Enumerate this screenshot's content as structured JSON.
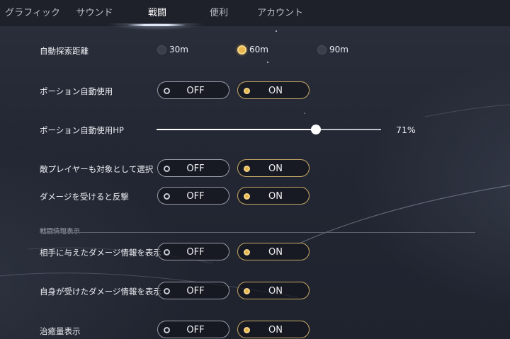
{
  "tabs": [
    {
      "label": "グラフィック"
    },
    {
      "label": "サウンド"
    },
    {
      "label": "戦闘"
    },
    {
      "label": "便利"
    },
    {
      "label": "アカウント"
    }
  ],
  "active_tab": "戦闘",
  "auto_search": {
    "label": "自動探索距離",
    "options": [
      "30m",
      "60m",
      "90m"
    ],
    "selected": "60m"
  },
  "potion_auto": {
    "label": "ポーション自動使用",
    "off": "OFF",
    "on": "ON",
    "value": "ON"
  },
  "potion_hp": {
    "label": "ポーション自動使用HP",
    "value_text": "71%",
    "value": 0.71
  },
  "target_player": {
    "label": "敵プレイヤーも対象として選択",
    "off": "OFF",
    "on": "ON",
    "value": "ON"
  },
  "counterattack": {
    "label": "ダメージを受けると反撃",
    "off": "OFF",
    "on": "ON",
    "value": "ON"
  },
  "battle_info_section": {
    "label": "戦闘情報表示"
  },
  "show_dealt": {
    "label": "相手に与えたダメージ情報を表示",
    "off": "OFF",
    "on": "ON",
    "value": "ON"
  },
  "show_taken": {
    "label": "自身が受けたダメージ情報を表示",
    "off": "OFF",
    "on": "ON",
    "value": "ON"
  },
  "heal_display": {
    "label": "治癒量表示",
    "off": "OFF",
    "on": "ON",
    "value": "ON"
  },
  "colors": {
    "accent": "#e6b54a",
    "on_border": "#c7a866",
    "off_border": "#9a9da6"
  }
}
